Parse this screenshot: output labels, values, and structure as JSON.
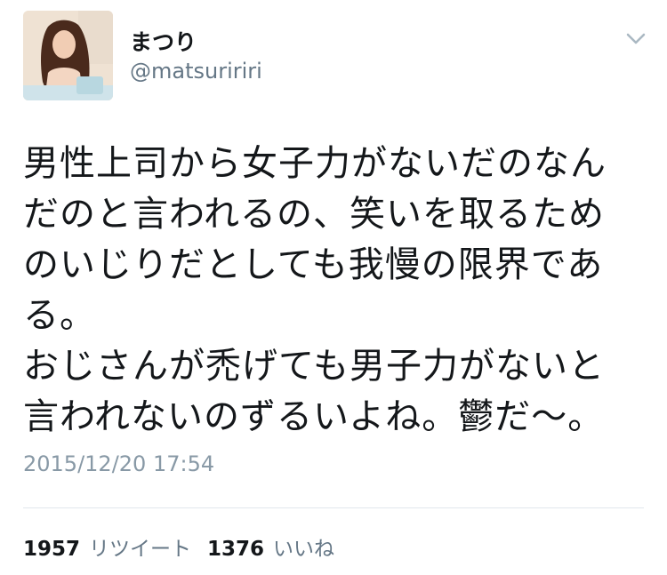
{
  "user": {
    "display_name": "まつり",
    "handle": "@matsuririri"
  },
  "tweet": {
    "text": "男性上司から女子力がないだのなん\nだのと言われるの、笑いを取るため\nのいじりだとしても我慢の限界であ\nる。\nおじさんが禿げても男子力がないと\n言われないのずるいよね。鬱だ〜。",
    "timestamp": "2015/12/20 17:54"
  },
  "stats": {
    "retweets_count": "1957",
    "retweets_label": "リツイート",
    "likes_count": "1376",
    "likes_label": "いいね"
  },
  "icons": {
    "menu": "chevron-down-icon",
    "avatar": "profile-photo"
  },
  "colors": {
    "text_primary": "#14171a",
    "text_secondary": "#657786",
    "timestamp": "#8899a6",
    "divider": "#e1e8ed"
  }
}
